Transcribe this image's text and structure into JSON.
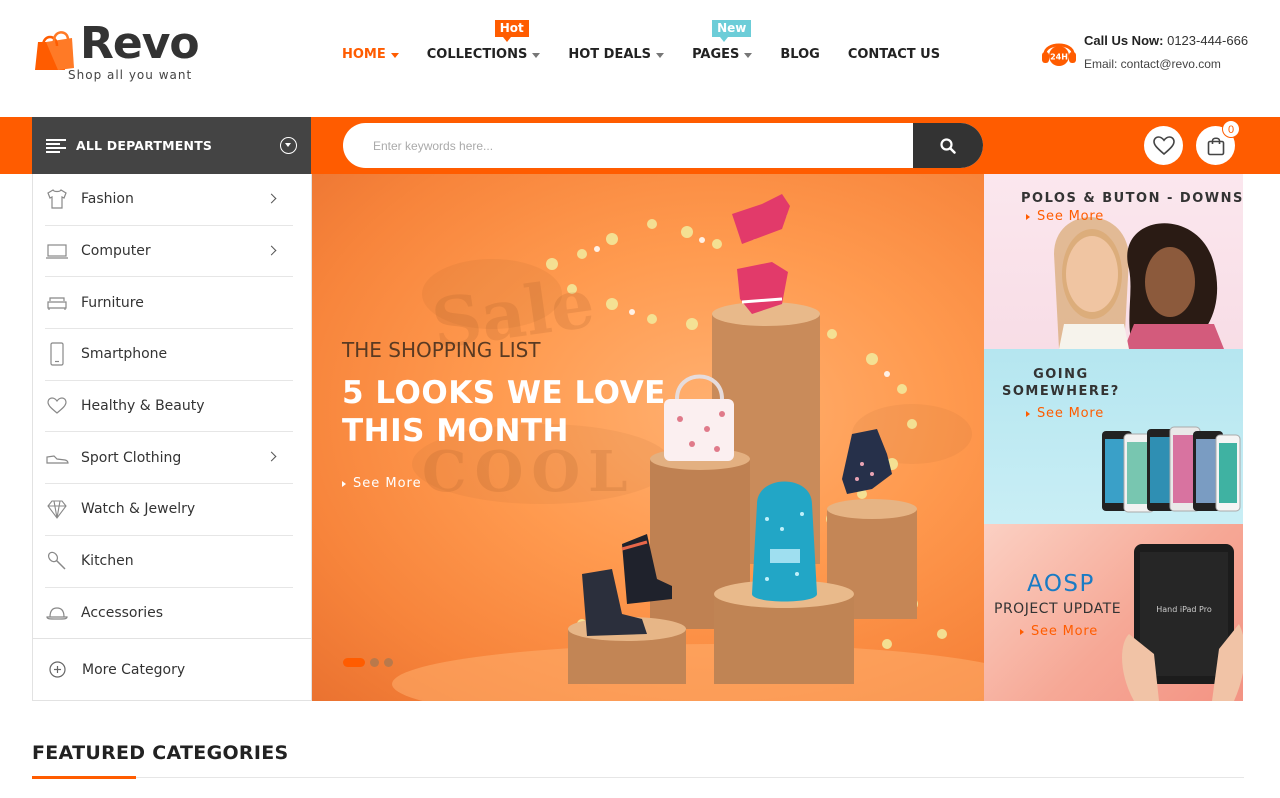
{
  "brand": {
    "name": "Revo",
    "tagline": "Shop all you want",
    "accent_color": "#ff5c00",
    "dark_color": "#444444"
  },
  "nav": {
    "items": [
      {
        "label": "HOME",
        "active": true,
        "has_dropdown": true,
        "badge": ""
      },
      {
        "label": "COLLECTIONS",
        "active": false,
        "has_dropdown": true,
        "badge": "Hot"
      },
      {
        "label": "HOT DEALS",
        "active": false,
        "has_dropdown": true,
        "badge": ""
      },
      {
        "label": "PAGES",
        "active": false,
        "has_dropdown": true,
        "badge": "New"
      },
      {
        "label": "BLOG",
        "active": false,
        "has_dropdown": false,
        "badge": ""
      },
      {
        "label": "CONTACT US",
        "active": false,
        "has_dropdown": false,
        "badge": ""
      }
    ]
  },
  "contact": {
    "icon": "24h-headset-icon",
    "icon_text": "24H",
    "call_label": "Call Us Now:",
    "phone": "0123-444-666",
    "email_line": "Email: contact@revo.com"
  },
  "departments": {
    "label": "ALL DEPARTMENTS",
    "categories": [
      {
        "label": "Fashion",
        "icon": "shirt-icon",
        "has_submenu": true
      },
      {
        "label": "Computer",
        "icon": "laptop-icon",
        "has_submenu": true
      },
      {
        "label": "Furniture",
        "icon": "sofa-icon",
        "has_submenu": false
      },
      {
        "label": "Smartphone",
        "icon": "smartphone-icon",
        "has_submenu": false
      },
      {
        "label": "Healthy & Beauty",
        "icon": "heart-icon",
        "has_submenu": false
      },
      {
        "label": "Sport Clothing",
        "icon": "sneaker-icon",
        "has_submenu": true
      },
      {
        "label": "Watch & Jewelry",
        "icon": "diamond-icon",
        "has_submenu": false
      },
      {
        "label": "Kitchen",
        "icon": "spoon-icon",
        "has_submenu": false
      },
      {
        "label": "Accessories",
        "icon": "hat-icon",
        "has_submenu": false
      }
    ],
    "more_label": "More Category"
  },
  "search": {
    "placeholder": "Enter keywords here...",
    "value": ""
  },
  "cart": {
    "count": "0"
  },
  "hero": {
    "subtitle": "THE SHOPPING LIST",
    "title": "5 LOOKS WE LOVE THIS MONTH",
    "cta": "See More",
    "slides": 3,
    "active_slide": 1
  },
  "banners": [
    {
      "title": "POLOS & BUTON - DOWNS",
      "cta": "See More"
    },
    {
      "title_line1": "GOING",
      "title_line2": "SOMEWHERE?",
      "cta": "See More"
    },
    {
      "title": "AOSP",
      "subtitle": "PROJECT UPDATE",
      "cta": "See More",
      "device_text": "Hand iPad Pro"
    }
  ],
  "featured": {
    "title": "FEATURED CATEGORIES"
  }
}
